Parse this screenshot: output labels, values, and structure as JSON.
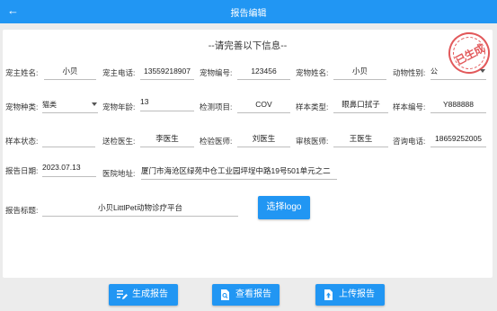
{
  "appbar": {
    "back_icon": "arrow-left-icon",
    "title": "报告编辑"
  },
  "form": {
    "heading": "--请完善以下信息--",
    "stamp": "已生成",
    "owner_name_label": "宠主姓名:",
    "owner_name": "小贝",
    "owner_phone_label": "宠主电话:",
    "owner_phone": "13559218907",
    "pet_id_label": "宠物编号:",
    "pet_id": "123456",
    "pet_name_label": "宠物姓名:",
    "pet_name": "小贝",
    "pet_sex_label": "动物性别:",
    "pet_sex": "公",
    "pet_species_label": "宠物种类:",
    "pet_species": "猫类",
    "pet_age_label": "宠物年龄:",
    "pet_age": "13",
    "test_item_label": "检测项目:",
    "test_item": "COV",
    "sample_type_label": "样本类型:",
    "sample_type": "眼鼻口拭子",
    "sample_no_label": "样本编号:",
    "sample_no": "Y888888",
    "sample_status_label": "样本状态:",
    "sample_status": "",
    "sender_doctor_label": "送检医生:",
    "sender_doctor": "李医生",
    "test_doctor_label": "检验医师:",
    "test_doctor": "刘医生",
    "review_doctor_label": "审核医师:",
    "review_doctor": "王医生",
    "consult_phone_label": "咨询电话:",
    "consult_phone": "18659252005",
    "report_date_label": "报告日期:",
    "report_date": "2023.07.13",
    "hospital_address_label": "医院地址:",
    "hospital_address": "厦门市海沧区绿苑中仓工业园坪埕中路19号501单元之二",
    "report_title_label": "报告标题:",
    "report_title": "小贝LittlPet动物诊疗平台",
    "select_logo_label": "选择logo"
  },
  "actions": {
    "generate": {
      "label": "生成报告",
      "icon": "edit-list-icon"
    },
    "view": {
      "label": "查看报告",
      "icon": "document-search-icon"
    },
    "upload": {
      "label": "上传报告",
      "icon": "upload-file-icon"
    }
  },
  "colors": {
    "primary": "#2196f3",
    "stamp": "#e2595b",
    "background": "#ececec"
  }
}
